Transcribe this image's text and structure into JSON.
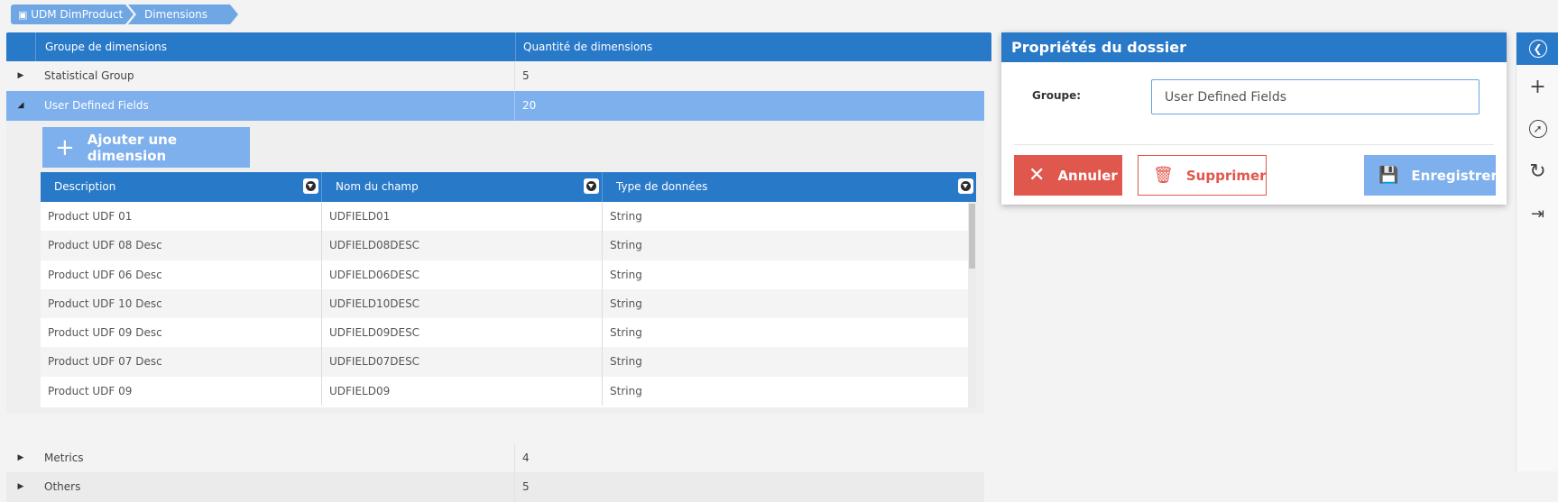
{
  "breadcrumb": {
    "items": [
      "UDM DimProduct",
      "Dimensions"
    ]
  },
  "main_grid": {
    "columns": [
      "Groupe de dimensions",
      "Quantité de dimensions"
    ],
    "rows": [
      {
        "group": "Statistical Group",
        "count": "5",
        "expanded": false
      },
      {
        "group": "User Defined Fields",
        "count": "20",
        "expanded": true
      },
      {
        "group": "Metrics",
        "count": "4",
        "expanded": false
      },
      {
        "group": "Others",
        "count": "5",
        "expanded": false
      }
    ]
  },
  "detail": {
    "add_button_label": "Ajouter une dimension",
    "columns": [
      "Description",
      "Nom du champ",
      "Type de données"
    ],
    "rows": [
      [
        "Product UDF 01",
        "UDFIELD01",
        "String"
      ],
      [
        "Product UDF 08 Desc",
        "UDFIELD08DESC",
        "String"
      ],
      [
        "Product UDF 06 Desc",
        "UDFIELD06DESC",
        "String"
      ],
      [
        "Product UDF 10 Desc",
        "UDFIELD10DESC",
        "String"
      ],
      [
        "Product UDF 09 Desc",
        "UDFIELD09DESC",
        "String"
      ],
      [
        "Product UDF 07 Desc",
        "UDFIELD07DESC",
        "String"
      ],
      [
        "Product UDF 09",
        "UDFIELD09",
        "String"
      ]
    ]
  },
  "properties_panel": {
    "title": "Propriétés du dossier",
    "group_label": "Groupe:",
    "group_value": "User Defined Fields",
    "cancel_label": "Annuler",
    "delete_label": "Supprimer",
    "save_label": "Enregistrer"
  },
  "toolbar": {
    "icons": [
      "back-icon",
      "plus-icon",
      "compass-icon",
      "refresh-icon",
      "logout-icon"
    ]
  },
  "colors": {
    "primary": "#2979c9",
    "light_blue": "#7eb0ed",
    "danger": "#e0574d"
  }
}
